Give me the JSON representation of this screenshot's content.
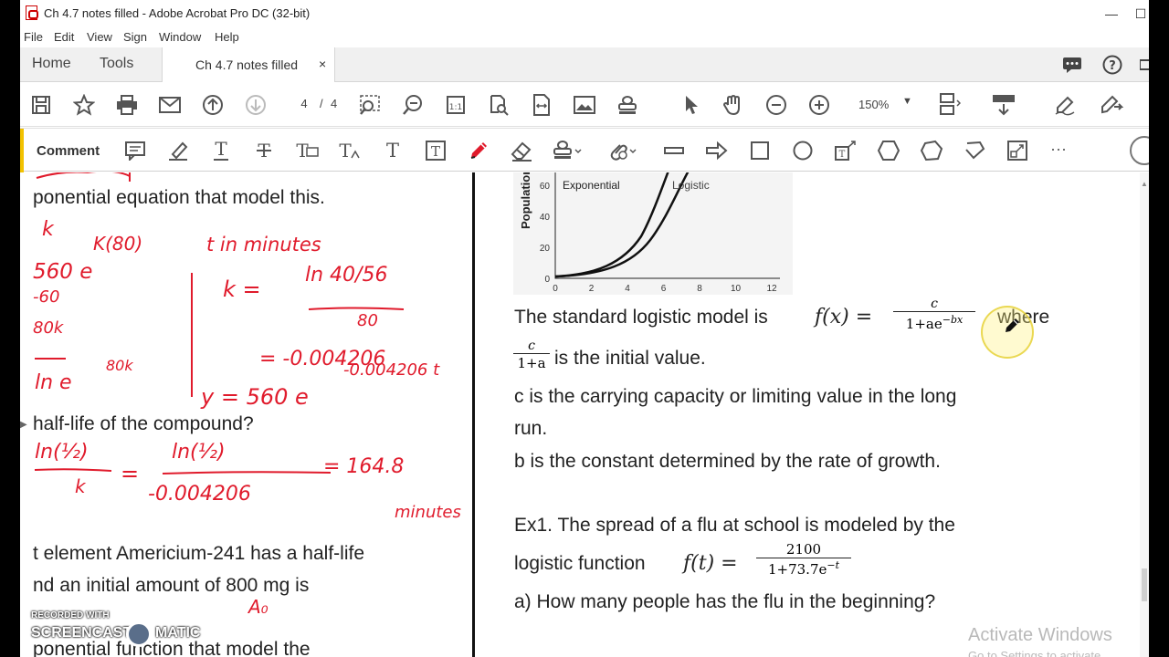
{
  "window": {
    "title": "Ch 4.7 notes filled - Adobe Acrobat Pro DC (32-bit)",
    "minimize": "—",
    "maximize": "☐"
  },
  "menu": [
    "File",
    "Edit",
    "View",
    "Sign",
    "Window",
    "Help"
  ],
  "tabs": {
    "home": "Home",
    "tools": "Tools",
    "document": "Ch 4.7 notes filled",
    "close": "×"
  },
  "toolbar": {
    "page_current": "4",
    "page_separator": "/",
    "page_total": "4",
    "zoom": "150%"
  },
  "comment_toolbar": {
    "label": "Comment",
    "more": "···"
  },
  "left_page": {
    "line1": "ponential equation that model this.",
    "line2": "half-life of the compound?",
    "line3": "t element Americium-241 has a half-life",
    "line4": "nd an initial amount of 800 mg is",
    "line5": "ponential function that model the",
    "ink": {
      "k": "k",
      "k_80": "K(80)",
      "t_in_minutes": "t in minutes",
      "e560": "560 e",
      "e_60": "-60",
      "k_eq": "k =",
      "ln_frac_num": "ln 40/56",
      "ln_frac_den": "80",
      "eq_80k": "80k",
      "ln_e": "ln e",
      "exp80k": "80k",
      "k_value": "= -0.004206",
      "y_eq": "y = 560 e",
      "y_exp": "-0.004206 t",
      "ln_half": "ln(½)",
      "ln_half_k": "k",
      "eq1": "=",
      "ln_half2": "ln(½)",
      "den2": "-0.004206",
      "eq2": "= 164.8",
      "minutes": "minutes",
      "A0": "A₀"
    }
  },
  "right_page": {
    "chart": {
      "ylabel": "Population",
      "series": [
        "Exponential",
        "Logistic"
      ],
      "yticks": [
        "0",
        "20",
        "40",
        "60"
      ],
      "xticks": [
        "0",
        "2",
        "4",
        "6",
        "8",
        "10",
        "12"
      ]
    },
    "para1_prefix": "The standard logistic model is ",
    "para1_fx": "f(x) =",
    "para1_num": "c",
    "para1_den": "1+ae",
    "para1_exp": "−bx",
    "para1_suffix": "where",
    "para2_num": "c",
    "para2_den": "1+a",
    "para2_suffix": "is the initial value.",
    "para3": "c is the carrying capacity or limiting value in the long",
    "para3b": "run.",
    "para4": "b is the constant determined by the rate of growth.",
    "ex1_line1": "Ex1. The spread of a flu at school is modeled by the",
    "ex1_line2_prefix": "logistic function ",
    "ex1_ft": "f(t) =",
    "ex1_num": "2100",
    "ex1_den": "1+73.7e",
    "ex1_exp": "−t",
    "ex1_a": "a) How many people has the flu in the beginning?"
  },
  "overlay": {
    "recorded_with": "RECORDED WITH",
    "screencast": "SCREENCAST",
    "matic": "MATIC",
    "activate_windows": "Activate Windows",
    "activate_sub": "Go to Settings to activate Windows."
  }
}
